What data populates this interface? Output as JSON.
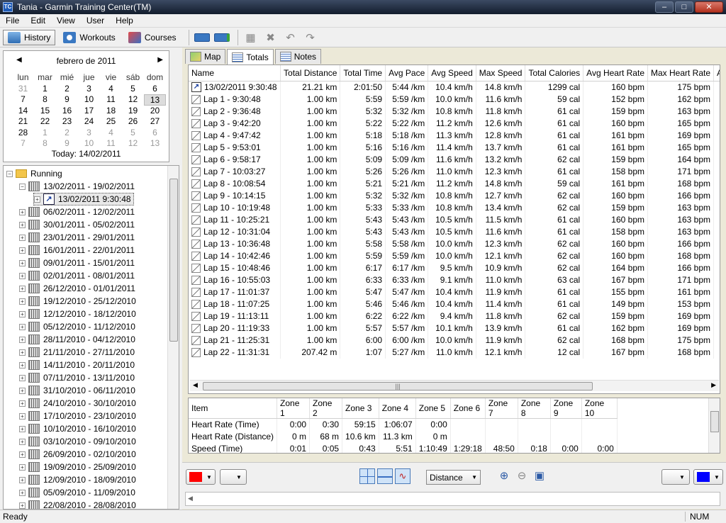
{
  "window": {
    "title": "Tania - Garmin Training Center(TM)",
    "icon": "app-icon",
    "controls": [
      "minimize",
      "maximize",
      "close"
    ]
  },
  "menu": [
    "File",
    "Edit",
    "View",
    "User",
    "Help"
  ],
  "toolbar": {
    "history": "History",
    "workouts": "Workouts",
    "courses": "Courses"
  },
  "calendar": {
    "month": "febrero de 2011",
    "weekdays": [
      "lun",
      "mar",
      "mié",
      "jue",
      "vie",
      "sáb",
      "dom"
    ],
    "weeks": [
      [
        {
          "d": "31",
          "dim": true
        },
        {
          "d": "1"
        },
        {
          "d": "2"
        },
        {
          "d": "3"
        },
        {
          "d": "4"
        },
        {
          "d": "5"
        },
        {
          "d": "6"
        }
      ],
      [
        {
          "d": "7"
        },
        {
          "d": "8"
        },
        {
          "d": "9"
        },
        {
          "d": "10"
        },
        {
          "d": "11"
        },
        {
          "d": "12"
        },
        {
          "d": "13",
          "today": true
        }
      ],
      [
        {
          "d": "14"
        },
        {
          "d": "15"
        },
        {
          "d": "16"
        },
        {
          "d": "17"
        },
        {
          "d": "18"
        },
        {
          "d": "19"
        },
        {
          "d": "20"
        }
      ],
      [
        {
          "d": "21"
        },
        {
          "d": "22"
        },
        {
          "d": "23"
        },
        {
          "d": "24"
        },
        {
          "d": "25"
        },
        {
          "d": "26"
        },
        {
          "d": "27"
        }
      ],
      [
        {
          "d": "28"
        },
        {
          "d": "1",
          "dim": true
        },
        {
          "d": "2",
          "dim": true
        },
        {
          "d": "3",
          "dim": true
        },
        {
          "d": "4",
          "dim": true
        },
        {
          "d": "5",
          "dim": true
        },
        {
          "d": "6",
          "dim": true
        }
      ],
      [
        {
          "d": "7",
          "dim": true
        },
        {
          "d": "8",
          "dim": true
        },
        {
          "d": "9",
          "dim": true
        },
        {
          "d": "10",
          "dim": true
        },
        {
          "d": "11",
          "dim": true
        },
        {
          "d": "12",
          "dim": true
        },
        {
          "d": "13",
          "dim": true
        }
      ]
    ],
    "today_label": "Today: 14/02/2011"
  },
  "tree": {
    "root": "Running",
    "open_week": "13/02/2011 - 19/02/2011",
    "activity": "13/02/2011 9:30:48",
    "weeks": [
      "06/02/2011 - 12/02/2011",
      "30/01/2011 - 05/02/2011",
      "23/01/2011 - 29/01/2011",
      "16/01/2011 - 22/01/2011",
      "09/01/2011 - 15/01/2011",
      "02/01/2011 - 08/01/2011",
      "26/12/2010 - 01/01/2011",
      "19/12/2010 - 25/12/2010",
      "12/12/2010 - 18/12/2010",
      "05/12/2010 - 11/12/2010",
      "28/11/2010 - 04/12/2010",
      "21/11/2010 - 27/11/2010",
      "14/11/2010 - 20/11/2010",
      "07/11/2010 - 13/11/2010",
      "31/10/2010 - 06/11/2010",
      "24/10/2010 - 30/10/2010",
      "17/10/2010 - 23/10/2010",
      "10/10/2010 - 16/10/2010",
      "03/10/2010 - 09/10/2010",
      "26/09/2010 - 02/10/2010",
      "19/09/2010 - 25/09/2010",
      "12/09/2010 - 18/09/2010",
      "05/09/2010 - 11/09/2010",
      "22/08/2010 - 28/08/2010"
    ]
  },
  "tabs": [
    "Map",
    "Totals",
    "Notes"
  ],
  "totals": {
    "columns": [
      "Name",
      "Total Distance",
      "Total Time",
      "Avg Pace",
      "Avg Speed",
      "Max Speed",
      "Total Calories",
      "Avg Heart Rate",
      "Max Heart Rate",
      "A"
    ],
    "rows": [
      [
        "13/02/2011 9:30:48",
        "21.21 km",
        "2:01:50",
        "5:44 /km",
        "10.4 km/h",
        "14.8 km/h",
        "1299 cal",
        "160 bpm",
        "175 bpm"
      ],
      [
        "Lap 1 - 9:30:48",
        "1.00 km",
        "5:59",
        "5:59 /km",
        "10.0 km/h",
        "11.6 km/h",
        "59 cal",
        "152 bpm",
        "162 bpm"
      ],
      [
        "Lap 2 - 9:36:48",
        "1.00 km",
        "5:32",
        "5:32 /km",
        "10.8 km/h",
        "11.8 km/h",
        "61 cal",
        "159 bpm",
        "163 bpm"
      ],
      [
        "Lap 3 - 9:42:20",
        "1.00 km",
        "5:22",
        "5:22 /km",
        "11.2 km/h",
        "12.6 km/h",
        "61 cal",
        "160 bpm",
        "165 bpm"
      ],
      [
        "Lap 4 - 9:47:42",
        "1.00 km",
        "5:18",
        "5:18 /km",
        "11.3 km/h",
        "12.8 km/h",
        "61 cal",
        "161 bpm",
        "169 bpm"
      ],
      [
        "Lap 5 - 9:53:01",
        "1.00 km",
        "5:16",
        "5:16 /km",
        "11.4 km/h",
        "13.7 km/h",
        "61 cal",
        "161 bpm",
        "165 bpm"
      ],
      [
        "Lap 6 - 9:58:17",
        "1.00 km",
        "5:09",
        "5:09 /km",
        "11.6 km/h",
        "13.2 km/h",
        "62 cal",
        "159 bpm",
        "164 bpm"
      ],
      [
        "Lap 7 - 10:03:27",
        "1.00 km",
        "5:26",
        "5:26 /km",
        "11.0 km/h",
        "12.3 km/h",
        "61 cal",
        "158 bpm",
        "171 bpm"
      ],
      [
        "Lap 8 - 10:08:54",
        "1.00 km",
        "5:21",
        "5:21 /km",
        "11.2 km/h",
        "14.8 km/h",
        "59 cal",
        "161 bpm",
        "168 bpm"
      ],
      [
        "Lap 9 - 10:14:15",
        "1.00 km",
        "5:32",
        "5:32 /km",
        "10.8 km/h",
        "12.7 km/h",
        "62 cal",
        "160 bpm",
        "166 bpm"
      ],
      [
        "Lap 10 - 10:19:48",
        "1.00 km",
        "5:33",
        "5:33 /km",
        "10.8 km/h",
        "13.4 km/h",
        "62 cal",
        "159 bpm",
        "163 bpm"
      ],
      [
        "Lap 11 - 10:25:21",
        "1.00 km",
        "5:43",
        "5:43 /km",
        "10.5 km/h",
        "11.5 km/h",
        "61 cal",
        "160 bpm",
        "163 bpm"
      ],
      [
        "Lap 12 - 10:31:04",
        "1.00 km",
        "5:43",
        "5:43 /km",
        "10.5 km/h",
        "11.6 km/h",
        "61 cal",
        "158 bpm",
        "163 bpm"
      ],
      [
        "Lap 13 - 10:36:48",
        "1.00 km",
        "5:58",
        "5:58 /km",
        "10.0 km/h",
        "12.3 km/h",
        "62 cal",
        "160 bpm",
        "166 bpm"
      ],
      [
        "Lap 14 - 10:42:46",
        "1.00 km",
        "5:59",
        "5:59 /km",
        "10.0 km/h",
        "12.1 km/h",
        "62 cal",
        "160 bpm",
        "168 bpm"
      ],
      [
        "Lap 15 - 10:48:46",
        "1.00 km",
        "6:17",
        "6:17 /km",
        "9.5 km/h",
        "10.9 km/h",
        "62 cal",
        "164 bpm",
        "166 bpm"
      ],
      [
        "Lap 16 - 10:55:03",
        "1.00 km",
        "6:33",
        "6:33 /km",
        "9.1 km/h",
        "11.0 km/h",
        "63 cal",
        "167 bpm",
        "171 bpm"
      ],
      [
        "Lap 17 - 11:01:37",
        "1.00 km",
        "5:47",
        "5:47 /km",
        "10.4 km/h",
        "11.9 km/h",
        "61 cal",
        "155 bpm",
        "161 bpm"
      ],
      [
        "Lap 18 - 11:07:25",
        "1.00 km",
        "5:46",
        "5:46 /km",
        "10.4 km/h",
        "11.4 km/h",
        "61 cal",
        "149 bpm",
        "153 bpm"
      ],
      [
        "Lap 19 - 11:13:11",
        "1.00 km",
        "6:22",
        "6:22 /km",
        "9.4 km/h",
        "11.8 km/h",
        "62 cal",
        "159 bpm",
        "169 bpm"
      ],
      [
        "Lap 20 - 11:19:33",
        "1.00 km",
        "5:57",
        "5:57 /km",
        "10.1 km/h",
        "13.9 km/h",
        "61 cal",
        "162 bpm",
        "169 bpm"
      ],
      [
        "Lap 21 - 11:25:31",
        "1.00 km",
        "6:00",
        "6:00 /km",
        "10.0 km/h",
        "11.9 km/h",
        "62 cal",
        "168 bpm",
        "175 bpm"
      ],
      [
        "Lap 22 - 11:31:31",
        "207.42 m",
        "1:07",
        "5:27 /km",
        "11.0 km/h",
        "12.1 km/h",
        "12 cal",
        "167 bpm",
        "168 bpm"
      ]
    ]
  },
  "zones": {
    "columns": [
      "Item",
      "Zone 1",
      "Zone 2",
      "Zone 3",
      "Zone 4",
      "Zone 5",
      "Zone 6",
      "Zone 7",
      "Zone 8",
      "Zone 9",
      "Zone 10"
    ],
    "rows": [
      [
        "Heart Rate (Time)",
        "0:00",
        "0:30",
        "59:15",
        "1:06:07",
        "0:00",
        "",
        "",
        "",
        "",
        ""
      ],
      [
        "Heart Rate (Distance)",
        "0 m",
        "68 m",
        "10.6 km",
        "11.3 km",
        "0 m",
        "",
        "",
        "",
        "",
        ""
      ],
      [
        "Speed (Time)",
        "0:01",
        "0:05",
        "0:43",
        "5:51",
        "1:10:49",
        "1:29:18",
        "48:50",
        "0:18",
        "0:00",
        "0:00"
      ]
    ]
  },
  "graph": {
    "color1": "#ff0000",
    "color2": "#0000ff",
    "x_axis": "Distance"
  },
  "colors": {
    "accent": "#2b5aa5"
  },
  "status": {
    "message": "Ready",
    "num": "NUM"
  }
}
